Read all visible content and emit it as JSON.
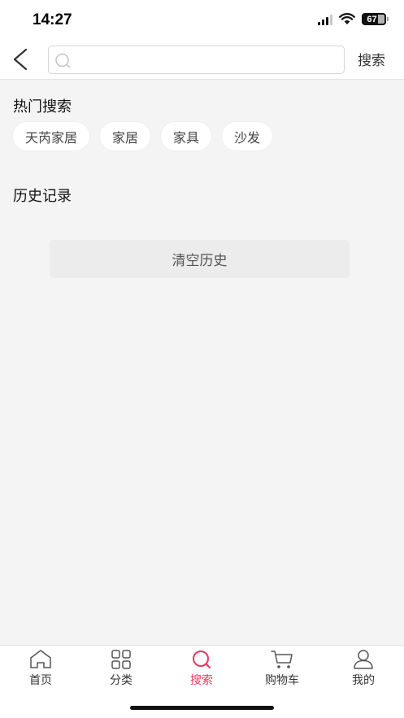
{
  "status_bar": {
    "time": "14:27",
    "battery": "67",
    "icons": [
      "signal-icon",
      "wifi-icon",
      "battery-icon"
    ]
  },
  "header": {
    "back_icon": "chevron-left-icon",
    "search_placeholder": "",
    "search_value": "",
    "search_button": "搜索"
  },
  "hot_search": {
    "title": "热门搜索",
    "tags": [
      "天芮家居",
      "家居",
      "家具",
      "沙发"
    ]
  },
  "history": {
    "title": "历史记录",
    "clear_label": "清空历史"
  },
  "tabbar": {
    "active": "搜索",
    "active_color": "#e8385d",
    "items": [
      {
        "label": "首页",
        "icon": "home-icon"
      },
      {
        "label": "分类",
        "icon": "grid-icon"
      },
      {
        "label": "搜索",
        "icon": "search-icon"
      },
      {
        "label": "购物车",
        "icon": "cart-icon"
      },
      {
        "label": "我的",
        "icon": "user-icon"
      }
    ]
  }
}
